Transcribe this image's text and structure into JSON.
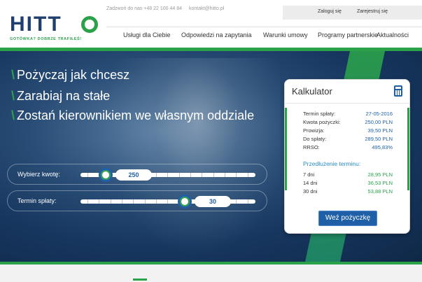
{
  "brand": {
    "logo_text": "HITT",
    "tagline": "GOTÓWKA? DOBRZE TRAFIŁEŚ!"
  },
  "topbar": {
    "phone": "Zadzwoń do nas +48 22 100 44 84",
    "email": "kontakt@hitto.pl"
  },
  "auth": {
    "login": "Zaloguj się",
    "register": "Zarejestruj się"
  },
  "nav": [
    "Usługi dla Ciebie",
    "Odpowiedzi na zapytania",
    "Warunki umowy",
    "Programy partnerskie",
    "Aktualności"
  ],
  "slogans": [
    "Pożyczaj jak chcesz",
    "Zarabiaj na stałe",
    "Zostań kierownikiem we własnym oddziale"
  ],
  "sliders": {
    "amount": {
      "label": "Wybierz kwotę:",
      "value": "250",
      "level": 0.15
    },
    "term": {
      "label": "Termin spłaty:",
      "value": "30",
      "level": 0.8
    }
  },
  "calculator": {
    "title": "Kalkulator",
    "rows": [
      {
        "label": "Termin spłaty:",
        "value": "27-05-2016"
      },
      {
        "label": "Kwota pożyczki:",
        "value": "250,00 PLN"
      },
      {
        "label": "Prowizja:",
        "value": "39,50 PLN"
      },
      {
        "label": "Do spłaty:",
        "value": "289,50 PLN"
      },
      {
        "label": "RRSO:",
        "value": "495,83%"
      }
    ],
    "extension_title": "Przedłużenie terminu:",
    "extensions": [
      {
        "label": "7 dni",
        "value": "28,95 PLN"
      },
      {
        "label": "14 dni",
        "value": "36,53 PLN"
      },
      {
        "label": "30 dni",
        "value": "53,88 PLN"
      }
    ],
    "button": "Weź pożyczkę"
  },
  "colors": {
    "brand_blue": "#1f3f6e",
    "accent_green": "#2ba24a",
    "link_blue": "#1f5fa8"
  }
}
